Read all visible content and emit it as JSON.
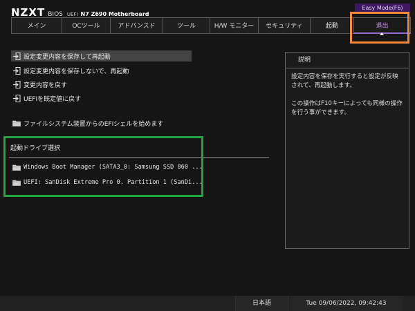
{
  "header": {
    "logo": "NZXT",
    "bios": "BIOS",
    "uefi": "UEFI",
    "model": "N7 Z690 Motherboard",
    "easy_mode": "Easy Mode(F6)"
  },
  "tabs": [
    {
      "label": "メイン"
    },
    {
      "label": "OCツール"
    },
    {
      "label": "アドバンスド"
    },
    {
      "label": "ツール"
    },
    {
      "label": "H/W モニター"
    },
    {
      "label": "セキュリティ"
    },
    {
      "label": "起動"
    },
    {
      "label": "退出"
    }
  ],
  "active_tab": "退出",
  "menu": [
    {
      "label": "設定変更内容を保存して再起動",
      "icon": "exit-arrow-icon"
    },
    {
      "label": "設定変更内容を保存しないで、再起動",
      "icon": "exit-arrow-icon"
    },
    {
      "label": "変更内容を戻す",
      "icon": "exit-arrow-icon"
    },
    {
      "label": "UEFIを既定値に戻す",
      "icon": "exit-arrow-icon"
    },
    {
      "label": "ファイルシステム装置からのEFIシェルを始めます",
      "icon": "folder-icon"
    }
  ],
  "boot_override": {
    "title": "起動ドライブ選択",
    "items": [
      {
        "label": "Windows Boot Manager (SATA3_0: Samsung SSD 860 ...",
        "icon": "folder-icon"
      },
      {
        "label": "UEFI: SanDisk Extreme Pro 0. Partition 1 (SanDi...",
        "icon": "folder-icon"
      }
    ]
  },
  "description": {
    "title": "説明",
    "text": "設定内容を保存を実行すると設定が反映されて、再起動します。\n\nこの操作はF10キーによっても同様の操作を行う事ができます。"
  },
  "footer": {
    "language": "日本語",
    "datetime": "Tue 09/06/2022, 09:42:43"
  },
  "colors": {
    "accent_purple": "#d18cf0",
    "highlight_orange": "#f58a3b",
    "highlight_green": "#1fa543"
  }
}
